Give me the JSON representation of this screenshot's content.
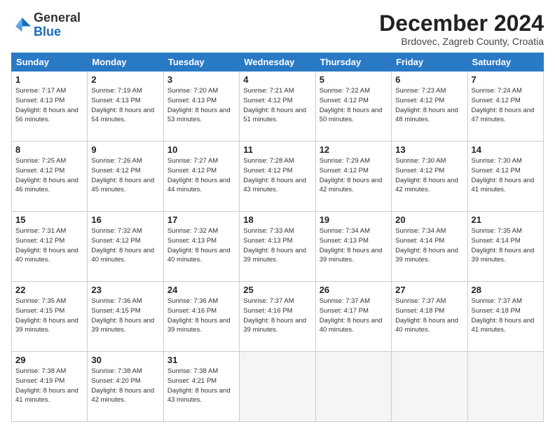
{
  "logo": {
    "general": "General",
    "blue": "Blue"
  },
  "header": {
    "month": "December 2024",
    "location": "Brdovec, Zagreb County, Croatia"
  },
  "weekdays": [
    "Sunday",
    "Monday",
    "Tuesday",
    "Wednesday",
    "Thursday",
    "Friday",
    "Saturday"
  ],
  "weeks": [
    [
      {
        "day": 1,
        "sunrise": "7:17 AM",
        "sunset": "4:13 PM",
        "daylight": "8 hours and 56 minutes."
      },
      {
        "day": 2,
        "sunrise": "7:19 AM",
        "sunset": "4:13 PM",
        "daylight": "8 hours and 54 minutes."
      },
      {
        "day": 3,
        "sunrise": "7:20 AM",
        "sunset": "4:13 PM",
        "daylight": "8 hours and 53 minutes."
      },
      {
        "day": 4,
        "sunrise": "7:21 AM",
        "sunset": "4:12 PM",
        "daylight": "8 hours and 51 minutes."
      },
      {
        "day": 5,
        "sunrise": "7:22 AM",
        "sunset": "4:12 PM",
        "daylight": "8 hours and 50 minutes."
      },
      {
        "day": 6,
        "sunrise": "7:23 AM",
        "sunset": "4:12 PM",
        "daylight": "8 hours and 48 minutes."
      },
      {
        "day": 7,
        "sunrise": "7:24 AM",
        "sunset": "4:12 PM",
        "daylight": "8 hours and 47 minutes."
      }
    ],
    [
      {
        "day": 8,
        "sunrise": "7:25 AM",
        "sunset": "4:12 PM",
        "daylight": "8 hours and 46 minutes."
      },
      {
        "day": 9,
        "sunrise": "7:26 AM",
        "sunset": "4:12 PM",
        "daylight": "8 hours and 45 minutes."
      },
      {
        "day": 10,
        "sunrise": "7:27 AM",
        "sunset": "4:12 PM",
        "daylight": "8 hours and 44 minutes."
      },
      {
        "day": 11,
        "sunrise": "7:28 AM",
        "sunset": "4:12 PM",
        "daylight": "8 hours and 43 minutes."
      },
      {
        "day": 12,
        "sunrise": "7:29 AM",
        "sunset": "4:12 PM",
        "daylight": "8 hours and 42 minutes."
      },
      {
        "day": 13,
        "sunrise": "7:30 AM",
        "sunset": "4:12 PM",
        "daylight": "8 hours and 42 minutes."
      },
      {
        "day": 14,
        "sunrise": "7:30 AM",
        "sunset": "4:12 PM",
        "daylight": "8 hours and 41 minutes."
      }
    ],
    [
      {
        "day": 15,
        "sunrise": "7:31 AM",
        "sunset": "4:12 PM",
        "daylight": "8 hours and 40 minutes."
      },
      {
        "day": 16,
        "sunrise": "7:32 AM",
        "sunset": "4:12 PM",
        "daylight": "8 hours and 40 minutes."
      },
      {
        "day": 17,
        "sunrise": "7:32 AM",
        "sunset": "4:13 PM",
        "daylight": "8 hours and 40 minutes."
      },
      {
        "day": 18,
        "sunrise": "7:33 AM",
        "sunset": "4:13 PM",
        "daylight": "8 hours and 39 minutes."
      },
      {
        "day": 19,
        "sunrise": "7:34 AM",
        "sunset": "4:13 PM",
        "daylight": "8 hours and 39 minutes."
      },
      {
        "day": 20,
        "sunrise": "7:34 AM",
        "sunset": "4:14 PM",
        "daylight": "8 hours and 39 minutes."
      },
      {
        "day": 21,
        "sunrise": "7:35 AM",
        "sunset": "4:14 PM",
        "daylight": "8 hours and 39 minutes."
      }
    ],
    [
      {
        "day": 22,
        "sunrise": "7:35 AM",
        "sunset": "4:15 PM",
        "daylight": "8 hours and 39 minutes."
      },
      {
        "day": 23,
        "sunrise": "7:36 AM",
        "sunset": "4:15 PM",
        "daylight": "8 hours and 39 minutes."
      },
      {
        "day": 24,
        "sunrise": "7:36 AM",
        "sunset": "4:16 PM",
        "daylight": "8 hours and 39 minutes."
      },
      {
        "day": 25,
        "sunrise": "7:37 AM",
        "sunset": "4:16 PM",
        "daylight": "8 hours and 39 minutes."
      },
      {
        "day": 26,
        "sunrise": "7:37 AM",
        "sunset": "4:17 PM",
        "daylight": "8 hours and 40 minutes."
      },
      {
        "day": 27,
        "sunrise": "7:37 AM",
        "sunset": "4:18 PM",
        "daylight": "8 hours and 40 minutes."
      },
      {
        "day": 28,
        "sunrise": "7:37 AM",
        "sunset": "4:18 PM",
        "daylight": "8 hours and 41 minutes."
      }
    ],
    [
      {
        "day": 29,
        "sunrise": "7:38 AM",
        "sunset": "4:19 PM",
        "daylight": "8 hours and 41 minutes."
      },
      {
        "day": 30,
        "sunrise": "7:38 AM",
        "sunset": "4:20 PM",
        "daylight": "8 hours and 42 minutes."
      },
      {
        "day": 31,
        "sunrise": "7:38 AM",
        "sunset": "4:21 PM",
        "daylight": "8 hours and 43 minutes."
      },
      null,
      null,
      null,
      null
    ]
  ]
}
